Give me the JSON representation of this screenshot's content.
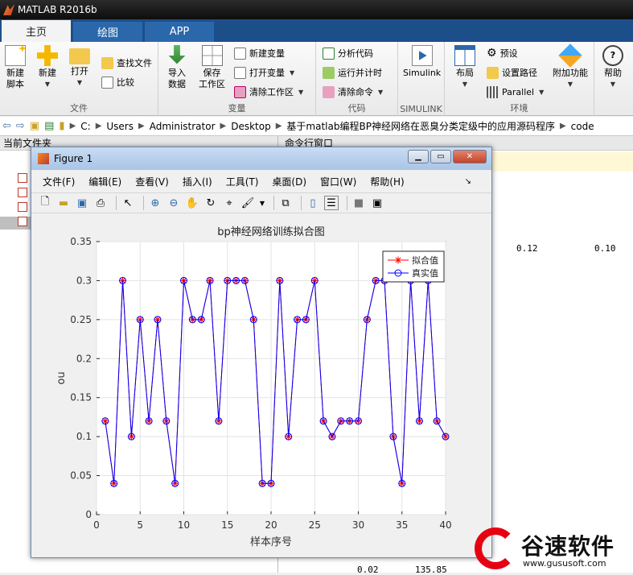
{
  "window": {
    "title": "MATLAB R2016b"
  },
  "tabs": [
    {
      "label": "主页",
      "active": true
    },
    {
      "label": "绘图",
      "active": false
    },
    {
      "label": "APP",
      "active": false
    }
  ],
  "ribbon": {
    "file": {
      "group_label": "文件",
      "new_script": "新建\n脚本",
      "new": "新建",
      "open": "打开",
      "find_files": "查找文件",
      "compare": "比较"
    },
    "variable": {
      "group_label": "变量",
      "import_data": "导入\n数据",
      "save_workspace": "保存\n工作区",
      "new_variable": "新建变量",
      "open_variable": "打开变量",
      "clear_workspace": "清除工作区"
    },
    "code": {
      "group_label": "代码",
      "analyze_code": "分析代码",
      "run_and_time": "运行并计时",
      "clear_commands": "清除命令"
    },
    "simulink": {
      "group_label": "SIMULINK",
      "simulink": "Simulink"
    },
    "environment": {
      "group_label": "环境",
      "layout": "布局",
      "preferences": "预设",
      "set_path": "设置路径",
      "parallel": "Parallel",
      "addons": "附加功能",
      "help": "帮助"
    }
  },
  "address": {
    "crumbs": [
      "C:",
      "Users",
      "Administrator",
      "Desktop",
      "基于matlab编程BP神经网络在恶臭分类定级中的应用源码程序",
      "code"
    ]
  },
  "left_panel": {
    "header": "当前文件夹"
  },
  "right_panel": {
    "header": "命令行窗口",
    "values": [
      "0.12",
      "0.10",
      "0.02",
      "135.85"
    ]
  },
  "figure": {
    "title": "Figure 1",
    "menu": [
      "文件(F)",
      "编辑(E)",
      "查看(V)",
      "插入(I)",
      "工具(T)",
      "桌面(D)",
      "窗口(W)",
      "帮助(H)"
    ]
  },
  "chart_data": {
    "type": "line",
    "title": "bp神经网络训练拟合图",
    "xlabel": "样本序号",
    "ylabel": "ou",
    "xlim": [
      0,
      40
    ],
    "ylim": [
      0,
      0.35
    ],
    "xticks": [
      0,
      5,
      10,
      15,
      20,
      25,
      30,
      35,
      40
    ],
    "yticks": [
      0,
      0.05,
      0.1,
      0.15,
      0.2,
      0.25,
      0.3,
      0.35
    ],
    "grid": true,
    "legend_position": "top-right",
    "x": [
      1,
      2,
      3,
      4,
      5,
      6,
      7,
      8,
      9,
      10,
      11,
      12,
      13,
      14,
      15,
      16,
      17,
      18,
      19,
      20,
      21,
      22,
      23,
      24,
      25,
      26,
      27,
      28,
      29,
      30,
      31,
      32,
      33,
      34,
      35,
      36,
      37,
      38,
      39,
      40
    ],
    "series": [
      {
        "name": "拟合值",
        "color": "#ff0000",
        "marker": "star",
        "values": [
          0.12,
          0.04,
          0.3,
          0.1,
          0.25,
          0.12,
          0.25,
          0.12,
          0.04,
          0.3,
          0.25,
          0.25,
          0.3,
          0.12,
          0.3,
          0.3,
          0.3,
          0.25,
          0.04,
          0.04,
          0.3,
          0.1,
          0.25,
          0.25,
          0.3,
          0.12,
          0.1,
          0.12,
          0.12,
          0.12,
          0.25,
          0.3,
          0.3,
          0.1,
          0.04,
          0.3,
          0.12,
          0.3,
          0.12,
          0.1
        ]
      },
      {
        "name": "真实值",
        "color": "#0000ff",
        "marker": "circle",
        "values": [
          0.12,
          0.04,
          0.3,
          0.1,
          0.25,
          0.12,
          0.25,
          0.12,
          0.04,
          0.3,
          0.25,
          0.25,
          0.3,
          0.12,
          0.3,
          0.3,
          0.3,
          0.25,
          0.04,
          0.04,
          0.3,
          0.1,
          0.25,
          0.25,
          0.3,
          0.12,
          0.1,
          0.12,
          0.12,
          0.12,
          0.25,
          0.3,
          0.3,
          0.1,
          0.04,
          0.3,
          0.12,
          0.3,
          0.12,
          0.1
        ]
      }
    ]
  },
  "watermark": {
    "name": "谷速软件",
    "url": "www.gususoft.com"
  }
}
